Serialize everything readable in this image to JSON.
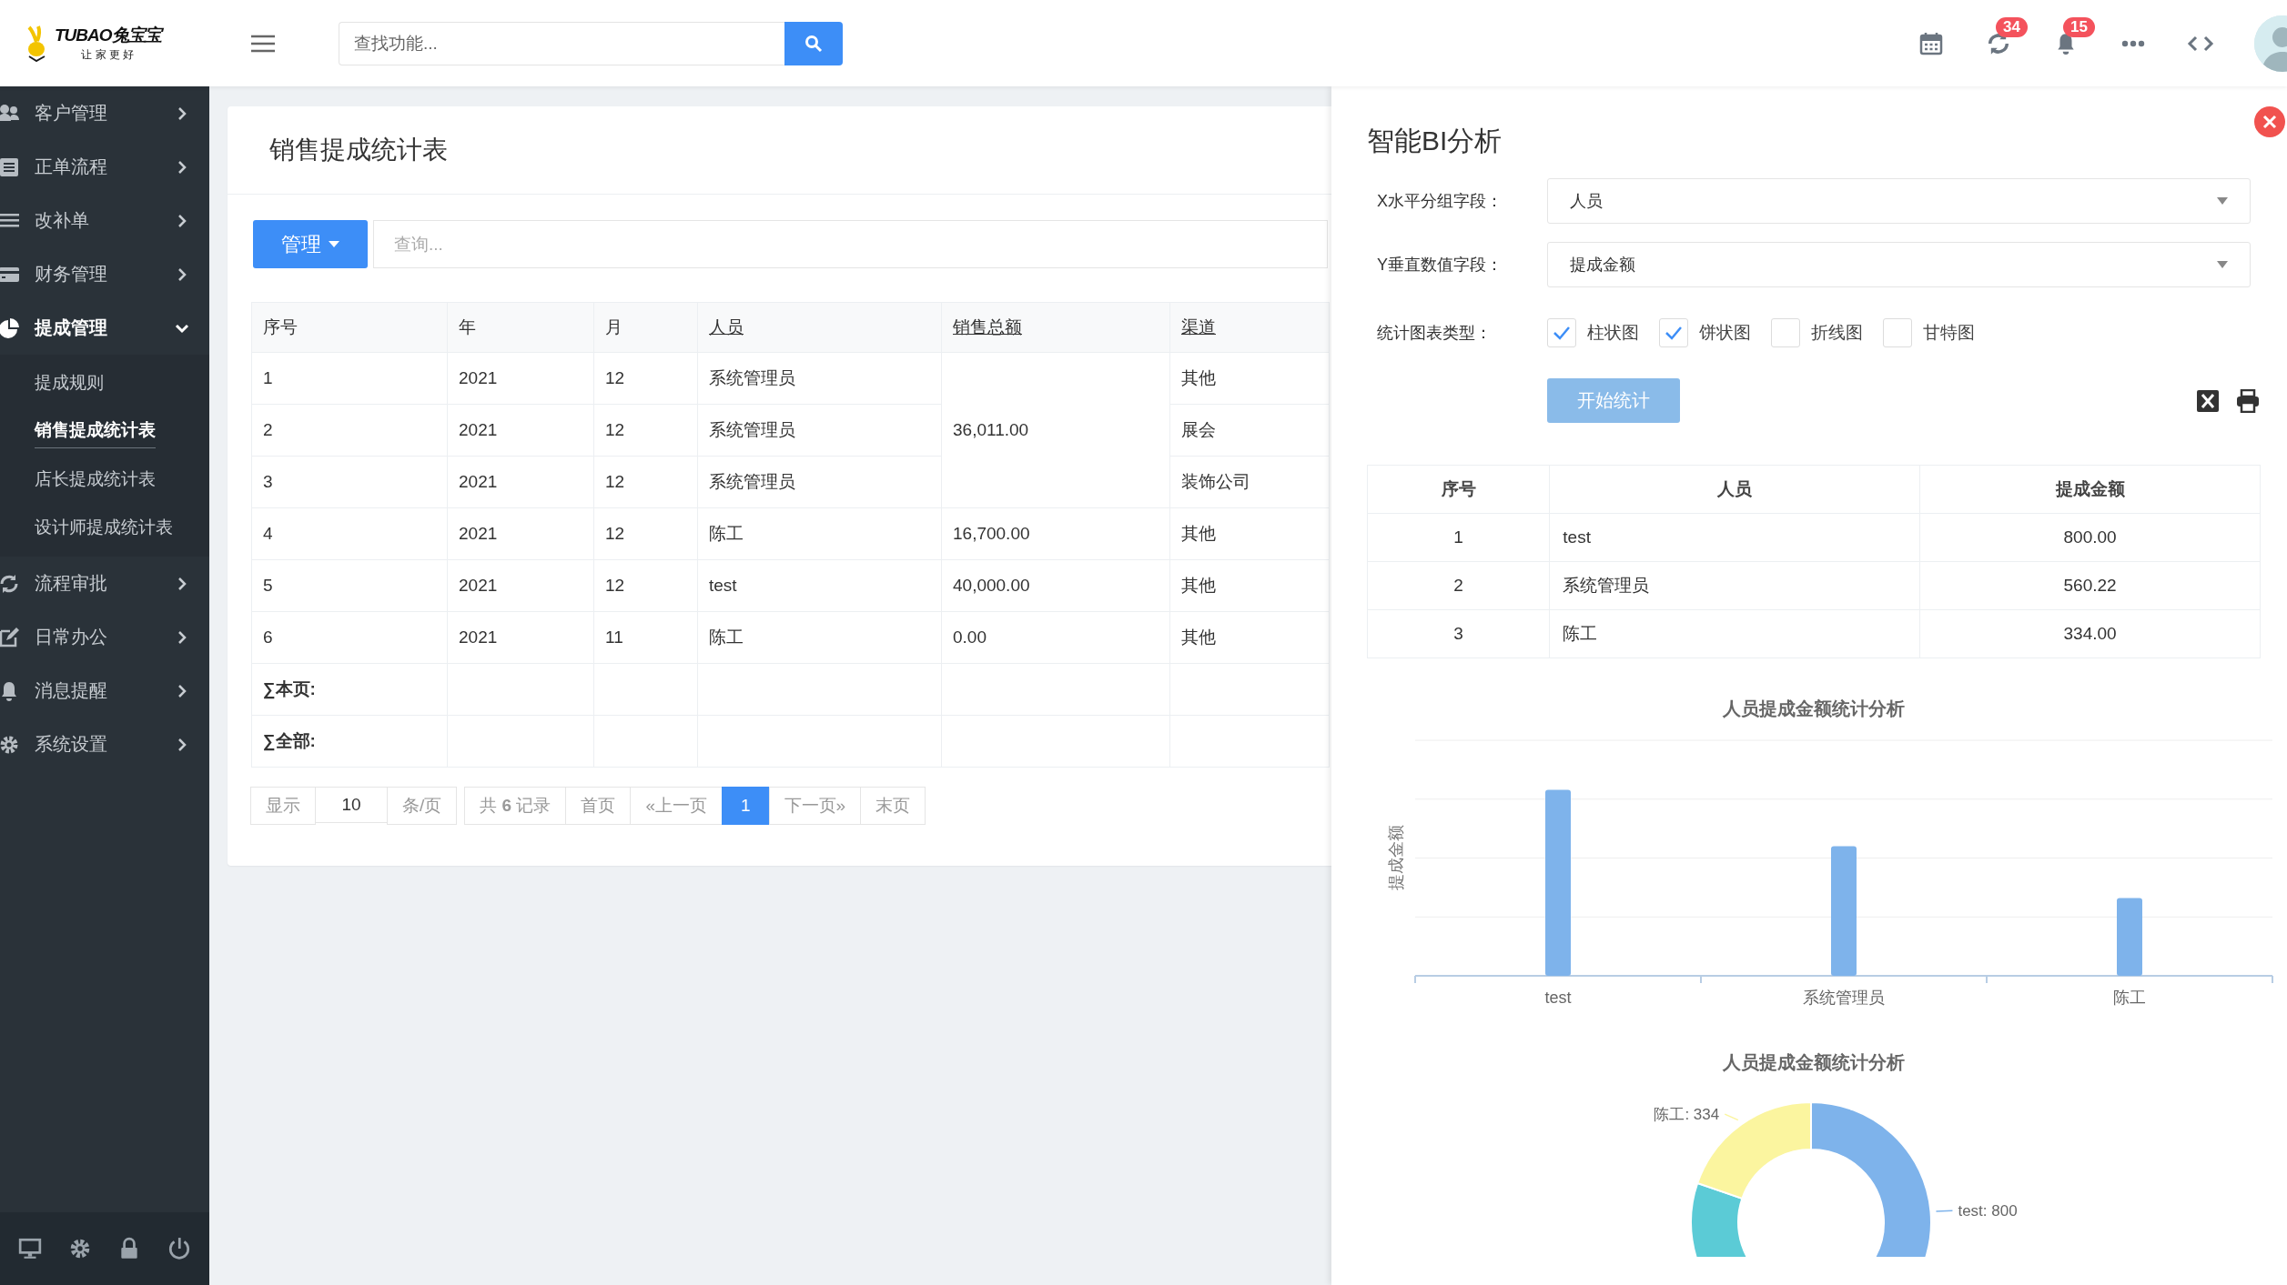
{
  "header": {
    "brand": "TUBAO兔宝宝",
    "slogan": "让 家 更 好",
    "search": {
      "placeholder": "查找功能..."
    },
    "refresh_badge": "34",
    "bell_badge": "15"
  },
  "sidebar": {
    "items": [
      {
        "label": "客户管理",
        "selected": false,
        "expanded": false
      },
      {
        "label": "正单流程",
        "selected": false,
        "expanded": false
      },
      {
        "label": "改补单",
        "selected": false,
        "expanded": false
      },
      {
        "label": "财务管理",
        "selected": false,
        "expanded": false
      },
      {
        "label": "提成管理",
        "selected": true,
        "expanded": true,
        "children": [
          {
            "label": "提成规则",
            "selected": false
          },
          {
            "label": "销售提成统计表",
            "selected": true
          },
          {
            "label": "店长提成统计表",
            "selected": false
          },
          {
            "label": "设计师提成统计表",
            "selected": false
          }
        ]
      },
      {
        "label": "流程审批",
        "selected": false,
        "expanded": false
      },
      {
        "label": "日常办公",
        "selected": false,
        "expanded": false
      },
      {
        "label": "消息提醒",
        "selected": false,
        "expanded": false
      },
      {
        "label": "系统设置",
        "selected": false,
        "expanded": false
      }
    ]
  },
  "main": {
    "title": "销售提成统计表",
    "manage_button": "管理",
    "query": {
      "placeholder": "查询..."
    },
    "table": {
      "columns": [
        {
          "label": "序号",
          "sortable": false
        },
        {
          "label": "年",
          "sortable": false
        },
        {
          "label": "月",
          "sortable": false
        },
        {
          "label": "人员",
          "sortable": true
        },
        {
          "label": "销售总额",
          "sortable": true
        },
        {
          "label": "渠道",
          "sortable": true
        }
      ],
      "rows": [
        {
          "no": "1",
          "year": "2021",
          "month": "12",
          "person": "系统管理员",
          "sales_total": "36,011.00",
          "channel": "其他"
        },
        {
          "no": "2",
          "year": "2021",
          "month": "12",
          "person": "系统管理员",
          "channel": "展会"
        },
        {
          "no": "3",
          "year": "2021",
          "month": "12",
          "person": "系统管理员",
          "channel": "装饰公司"
        },
        {
          "no": "4",
          "year": "2021",
          "month": "12",
          "person": "陈工",
          "sales_total": "16,700.00",
          "channel": "其他"
        },
        {
          "no": "5",
          "year": "2021",
          "month": "12",
          "person": "test",
          "sales_total": "40,000.00",
          "channel": "其他"
        },
        {
          "no": "6",
          "year": "2021",
          "month": "11",
          "person": "陈工",
          "sales_total": "0.00",
          "channel": "其他"
        }
      ],
      "summary_rows": [
        {
          "label": "∑本页:"
        },
        {
          "label": "∑全部:"
        }
      ]
    },
    "pagination": {
      "show_label": "显示",
      "page_size": "10",
      "per_page_label": "条/页",
      "total": "共 **6** 记录",
      "first": "首页",
      "prev": "«上一页",
      "pages": [
        {
          "label": "1",
          "selected": true
        }
      ],
      "next": "下一页»",
      "last": "末页"
    }
  },
  "bi_panel": {
    "title": "智能BI分析",
    "fields": [
      {
        "label": "X水平分组字段：",
        "value": "人员"
      },
      {
        "label": "Y垂直数值字段：",
        "value": "提成金额"
      }
    ],
    "chart_types_label": "统计图表类型：",
    "chart_types": [
      {
        "label": "柱状图",
        "checked": true
      },
      {
        "label": "饼状图",
        "checked": true
      },
      {
        "label": "折线图",
        "checked": false
      },
      {
        "label": "甘特图",
        "checked": false
      }
    ],
    "start_button": "开始统计",
    "result_table": {
      "columns": [
        "序号",
        "人员",
        "提成金额"
      ],
      "rows": [
        [
          "1",
          "test",
          "800.00"
        ],
        [
          "2",
          "系统管理员",
          "560.22"
        ],
        [
          "3",
          "陈工",
          "334.00"
        ]
      ]
    },
    "bar_chart": {
      "kind": "bar",
      "title": "人员提成金额统计分析",
      "axis_label": "提成金额",
      "categories": [
        "test",
        "系统管理员",
        "陈工"
      ]
    },
    "donut_chart": {
      "chart_data": {
        "type": "donut",
        "title": "人员提成金额统计分析",
        "colors": [
          "#7eb3eb",
          "#5bcbd6",
          "#fbf59f"
        ],
        "values": [
          800,
          560.22,
          334
        ],
        "value_labels": [
          "test: 800",
          null,
          "陈工: 334"
        ]
      }
    }
  }
}
